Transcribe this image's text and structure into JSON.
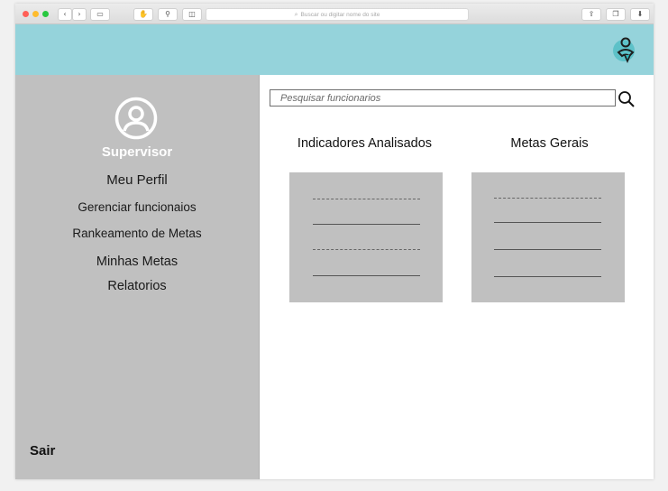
{
  "browser": {
    "url_placeholder": "Buscar ou digitar nome do site",
    "traffic_colors": [
      "#ff5f57",
      "#febc2e",
      "#28c840"
    ],
    "icons": [
      "back-icon",
      "forward-icon",
      "sidebar-icon",
      "hand-icon",
      "wrench-icon",
      "pocket-icon",
      "share-icon",
      "tabs-icon",
      "download-icon"
    ]
  },
  "header": {
    "color": "#95d3db",
    "logo_icon": "person-logo-icon"
  },
  "sidebar": {
    "role": "Supervisor",
    "items": [
      {
        "label": "Meu Perfil"
      },
      {
        "label": "Gerenciar funcionaios"
      },
      {
        "label": "Rankeamento de Metas"
      },
      {
        "label": "Minhas Metas"
      },
      {
        "label": "Relatorios"
      }
    ],
    "logout": "Sair",
    "avatar_icon": "user-avatar-icon",
    "background": "#c0c0c0"
  },
  "main": {
    "search": {
      "placeholder": "Pesquisar funcionarios",
      "value": ""
    },
    "search_icon": "search-icon",
    "panels": [
      {
        "title": "Indicadores Analisados"
      },
      {
        "title": "Metas Gerais"
      }
    ]
  }
}
